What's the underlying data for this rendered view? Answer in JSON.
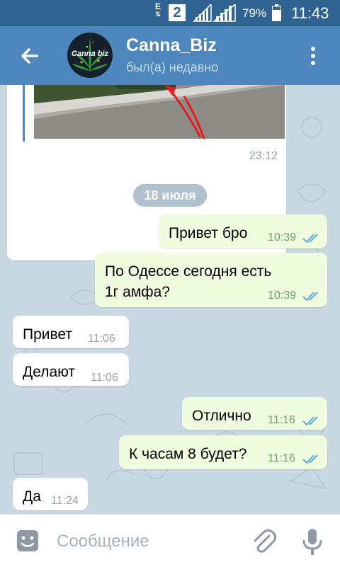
{
  "status_bar": {
    "network_letter": "E",
    "sim_slot": "2",
    "battery_percent": "79%",
    "time": "11:43"
  },
  "header": {
    "avatar_text": "Canna biz",
    "title": "Canna_Biz",
    "subtitle": "был(а) недавно",
    "back_icon": "back-arrow-icon",
    "menu_icon": "more-vert-icon"
  },
  "chat": {
    "media_message": {
      "time": "23:12"
    },
    "date_separator": "18 июля",
    "messages": [
      {
        "direction": "out",
        "text": "Привет бро",
        "time": "10:39",
        "read": true
      },
      {
        "direction": "out",
        "text": "По Одессе сегодня есть 1г амфа?",
        "time": "10:39",
        "read": true
      },
      {
        "direction": "in",
        "text": "Привет",
        "time": "11:06"
      },
      {
        "direction": "in",
        "text": "Делают",
        "time": "11:06"
      },
      {
        "direction": "out",
        "text": "Отлично",
        "time": "11:16",
        "read": true
      },
      {
        "direction": "out",
        "text": "К часам 8 будет?",
        "time": "11:16",
        "read": true
      },
      {
        "direction": "in",
        "text": "Да",
        "time": "11:24"
      }
    ]
  },
  "input": {
    "placeholder": "Сообщение",
    "emoji_icon": "emoji-icon",
    "attach_icon": "paperclip-icon",
    "mic_icon": "microphone-icon"
  },
  "colors": {
    "header": "#4d87be",
    "status_bar": "#2f6391",
    "outgoing_bubble": "#effdde",
    "incoming_bubble": "#ffffff",
    "read_check": "#5ea9dd"
  }
}
